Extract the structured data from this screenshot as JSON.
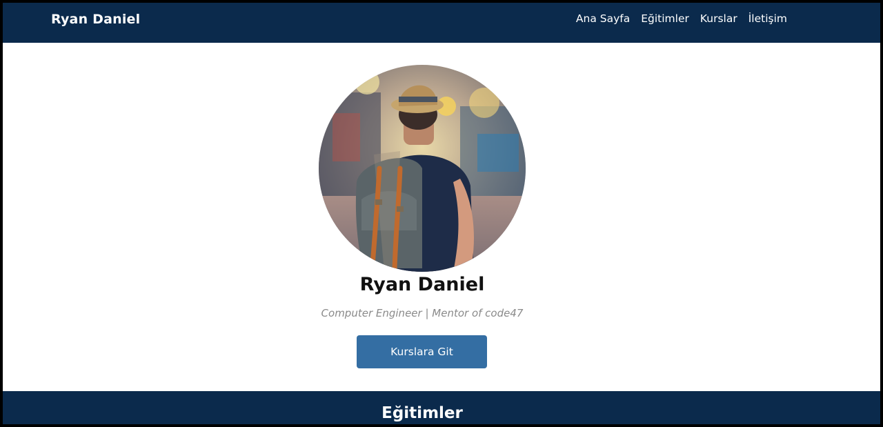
{
  "navbar": {
    "brand": "Ryan Daniel",
    "links": [
      {
        "label": "Ana Sayfa"
      },
      {
        "label": "Eğitimler"
      },
      {
        "label": "Kurslar"
      },
      {
        "label": "İletişim"
      }
    ]
  },
  "hero": {
    "avatar_alt": "profile photo of person with hat and backpack",
    "name": "Ryan Daniel",
    "subtitle": "Computer Engineer | Mentor of code47",
    "button_label": "Kurslara Git"
  },
  "section": {
    "title": "Eğitimler"
  },
  "colors": {
    "navbar_bg": "#0b2a4c",
    "button_bg": "#346ea3",
    "page_bg": "#ffffff",
    "frame": "#000000"
  }
}
